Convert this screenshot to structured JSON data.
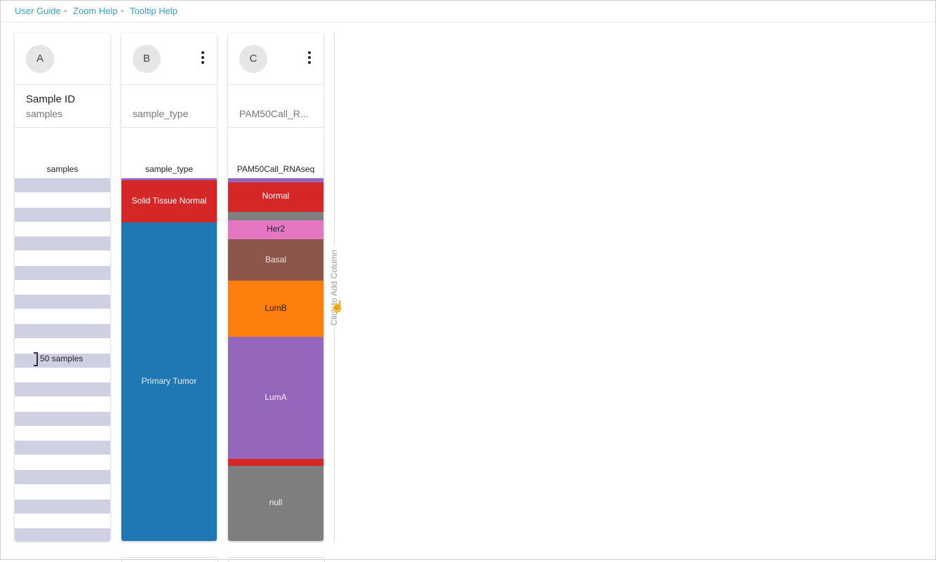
{
  "nav": {
    "links": [
      "User Guide",
      "Zoom Help",
      "Tooltip Help"
    ],
    "separator": "•"
  },
  "columns": [
    {
      "avatar": "A",
      "has_menu": false,
      "title": "Sample ID",
      "subtitle": "samples",
      "header_label": "samples",
      "badge": "50 samples",
      "stripe_color": "#cfd0e2"
    },
    {
      "avatar": "B",
      "has_menu": true,
      "title": "",
      "subtitle": "sample_type",
      "header_label": "sample_type",
      "segments": [
        {
          "label": "",
          "share": 0.006,
          "color": "#9467bd",
          "text_color": "#ffffff"
        },
        {
          "label": "Solid Tissue Normal",
          "share": 0.116,
          "color": "#d62728",
          "text_color": "#ffffff"
        },
        {
          "label": "Primary Tumor",
          "share": 0.878,
          "color": "#1f77b4",
          "text_color": "#e6eef6"
        }
      ]
    },
    {
      "avatar": "C",
      "has_menu": true,
      "title": "",
      "subtitle": "PAM50Call_R...",
      "header_label": "PAM50Call_RNAseq",
      "segments": [
        {
          "label": "",
          "share": 0.012,
          "color": "#9467bd",
          "text_color": "#ffffff"
        },
        {
          "label": "Normal",
          "share": 0.08,
          "color": "#d62728",
          "text_color": "#ffffff"
        },
        {
          "label": "",
          "share": 0.025,
          "color": "#7f7f7f",
          "text_color": "#ffffff"
        },
        {
          "label": "Her2",
          "share": 0.052,
          "color": "#e377c2",
          "text_color": "#222222"
        },
        {
          "label": "Basal",
          "share": 0.113,
          "color": "#8c564b",
          "text_color": "#f0e6e2"
        },
        {
          "label": "LumB",
          "share": 0.155,
          "color": "#ff7f0e",
          "text_color": "#222222"
        },
        {
          "label": "LumA",
          "share": 0.336,
          "color": "#9467bd",
          "text_color": "#f3edf8"
        },
        {
          "label": "",
          "share": 0.02,
          "color": "#d62728",
          "text_color": "#ffffff"
        },
        {
          "label": "null",
          "share": 0.207,
          "color": "#7f7f7f",
          "text_color": "#f0f0f0"
        }
      ]
    }
  ],
  "add_column": {
    "label": "Click to Add Column"
  }
}
